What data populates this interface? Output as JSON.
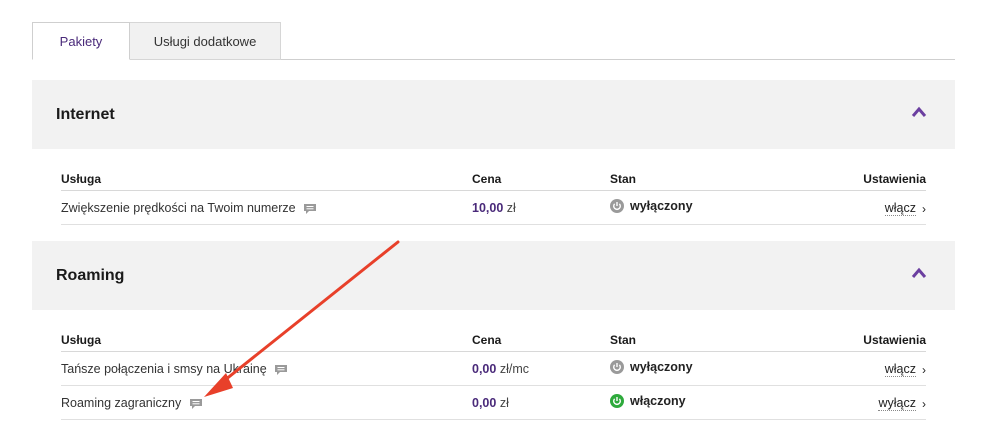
{
  "tabs": [
    {
      "label": "Pakiety",
      "active": true
    },
    {
      "label": "Usługi dodatkowe",
      "active": false
    }
  ],
  "columns": {
    "service": "Usługa",
    "price": "Cena",
    "state": "Stan",
    "settings": "Ustawienia"
  },
  "sections": [
    {
      "title": "Internet",
      "rows": [
        {
          "name": "Zwiększenie prędkości na Twoim numerze",
          "price_value": "10,00",
          "price_unit": "zł",
          "state": "wyłączony",
          "state_on": false,
          "action": "włącz"
        }
      ]
    },
    {
      "title": "Roaming",
      "rows": [
        {
          "name": "Tańsze połączenia i smsy na Ukrainę",
          "price_value": "0,00",
          "price_unit": "zł/mc",
          "state": "wyłączony",
          "state_on": false,
          "action": "włącz"
        },
        {
          "name": "Roaming zagraniczny",
          "price_value": "0,00",
          "price_unit": "zł",
          "state": "włączony",
          "state_on": true,
          "action": "wyłącz"
        }
      ]
    }
  ],
  "colors": {
    "accent": "#4a2a7a",
    "state_off": "#9a9a9a",
    "state_on": "#2eaa3c",
    "annotation_arrow": "#e8402a"
  }
}
